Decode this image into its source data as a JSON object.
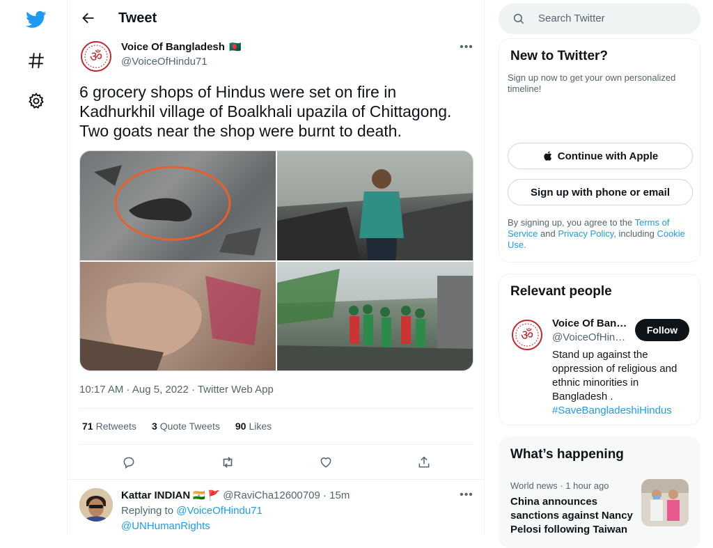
{
  "colors": {
    "brand": "#1d9bf0",
    "text": "#0f1419",
    "muted": "#536471",
    "border": "#eff3f4"
  },
  "nav": {
    "items": [
      {
        "icon": "twitter-bird-icon"
      },
      {
        "icon": "hashtag-icon"
      },
      {
        "icon": "gear-icon"
      }
    ]
  },
  "header": {
    "title": "Tweet"
  },
  "tweet": {
    "author_name": "Voice Of Bangladesh",
    "author_flag": "🇧🇩",
    "author_handle": "@VoiceOfHindu71",
    "text": "6 grocery shops of Hindus were set on fire in Kadhurkhil village of Boalkhali upazila of Chittagong. Two goats near the shop were burnt to death.",
    "timestamp": "10:17 AM · Aug 5, 2022 · Twitter Web App",
    "stats": {
      "retweets_count": "71",
      "retweets_label": "Retweets",
      "quotes_count": "3",
      "quotes_label": "Quote Tweets",
      "likes_count": "90",
      "likes_label": "Likes"
    }
  },
  "reply": {
    "author_name": "Kattar INDIAN",
    "author_flags": "🇮🇳 🚩",
    "author_handle": "@RaviCha12600709",
    "time_sep": "·",
    "time": "15m",
    "replying_prefix": "Replying to",
    "replying_to_1": "@VoiceOfHindu71",
    "replying_to_2": "@UNHumanRights"
  },
  "search": {
    "placeholder": "Search Twitter"
  },
  "new_to_twitter": {
    "title": "New to Twitter?",
    "subtitle": "Sign up now to get your own personalized timeline!",
    "apple_button": "Continue with Apple",
    "signup_button": "Sign up with phone or email",
    "legal_prefix": "By signing up, you agree to the",
    "terms_link": "Terms of Service",
    "and": "and",
    "privacy_link": "Privacy Policy",
    "including": ", including",
    "cookie_link": "Cookie Use."
  },
  "relevant_people": {
    "title": "Relevant people",
    "name": "Voice Of Ban…",
    "handle": "@VoiceOfHin…",
    "follow_label": "Follow",
    "bio": "Stand up against the oppression of religious and ethnic minorities in Bangladesh .",
    "hashtag": "#SaveBangladeshiHindus"
  },
  "whats_happening": {
    "title": "What’s happening",
    "items": [
      {
        "category": "World news",
        "sep": "·",
        "time": "1 hour ago",
        "headline": "China announces sanctions against Nancy Pelosi following Taiwan"
      }
    ]
  }
}
